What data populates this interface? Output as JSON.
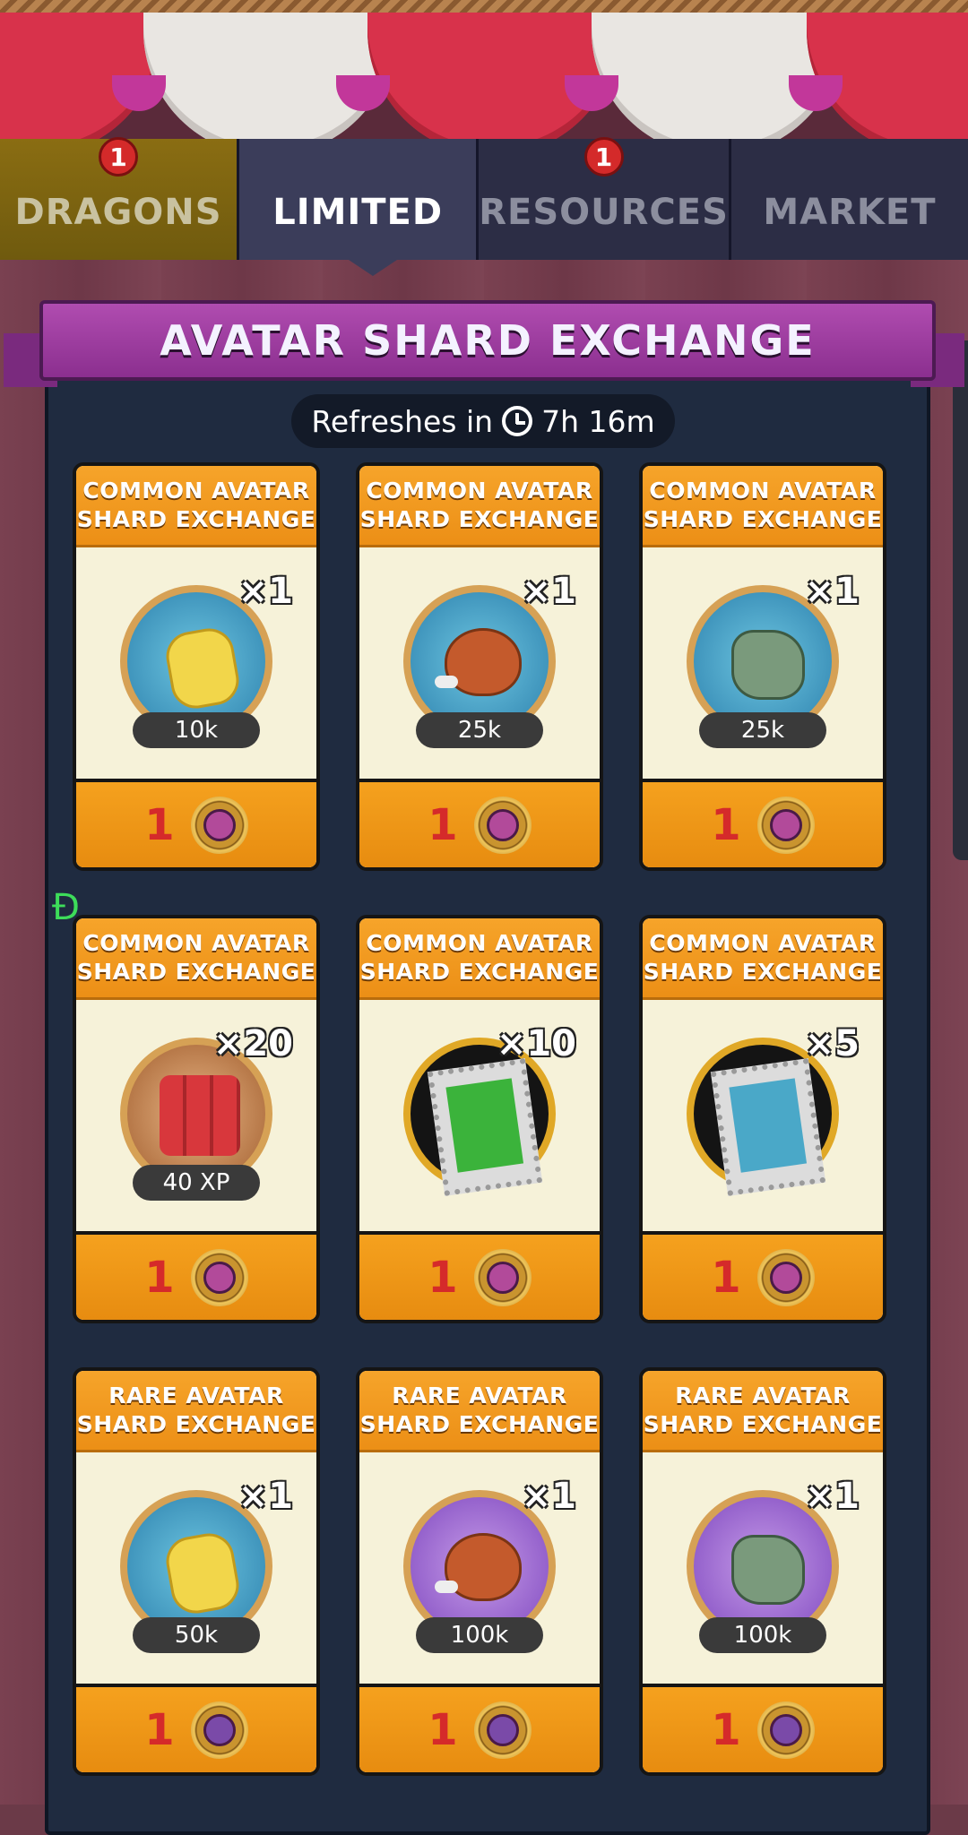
{
  "tabs": [
    {
      "label": "DRAGONS",
      "badge": "1"
    },
    {
      "label": "LIMITED",
      "badge": ""
    },
    {
      "label": "RESOURCES",
      "badge": "1"
    },
    {
      "label": "MARKET",
      "badge": ""
    }
  ],
  "banner": {
    "title": "AVATAR SHARD EXCHANGE"
  },
  "refresh": {
    "prefix": "Refreshes in",
    "time": "7h 16m"
  },
  "stray_glyph": "Đ",
  "cards": [
    {
      "title": "COMMON AVATAR\nSHARD EXCHANGE",
      "icon": "gold-icon",
      "qty": "×1",
      "amount": "10k",
      "cost": "1"
    },
    {
      "title": "COMMON AVATAR\nSHARD EXCHANGE",
      "icon": "food-icon",
      "qty": "×1",
      "amount": "25k",
      "cost": "1"
    },
    {
      "title": "COMMON AVATAR\nSHARD EXCHANGE",
      "icon": "stone-icon",
      "qty": "×1",
      "amount": "25k",
      "cost": "1"
    },
    {
      "title": "COMMON AVATAR\nSHARD EXCHANGE",
      "icon": "xp-steak-icon",
      "qty": "×20",
      "amount": "40 XP",
      "cost": "1"
    },
    {
      "title": "COMMON AVATAR\nSHARD EXCHANGE",
      "icon": "green-stamp-icon",
      "qty": "×10",
      "amount": "",
      "cost": "1"
    },
    {
      "title": "COMMON AVATAR\nSHARD EXCHANGE",
      "icon": "blue-stamp-icon",
      "qty": "×5",
      "amount": "",
      "cost": "1"
    },
    {
      "title": "RARE AVATAR\nSHARD EXCHANGE",
      "icon": "gold-icon",
      "qty": "×1",
      "amount": "50k",
      "cost": "1"
    },
    {
      "title": "RARE AVATAR\nSHARD EXCHANGE",
      "icon": "food-icon",
      "qty": "×1",
      "amount": "100k",
      "cost": "1"
    },
    {
      "title": "RARE AVATAR\nSHARD EXCHANGE",
      "icon": "stone-icon",
      "qty": "×1",
      "amount": "100k",
      "cost": "1"
    }
  ]
}
